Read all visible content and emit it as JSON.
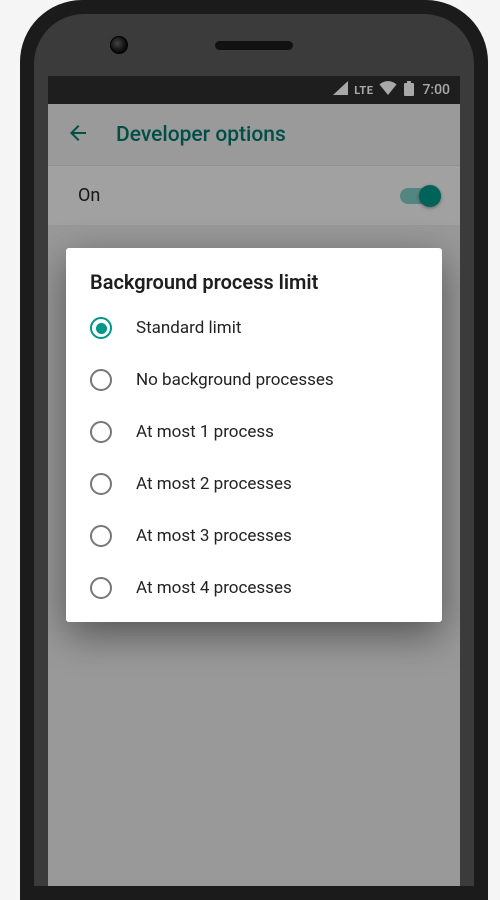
{
  "statusbar": {
    "network_label": "LTE",
    "time": "7:00"
  },
  "appbar": {
    "title": "Developer options"
  },
  "master_toggle": {
    "label": "On",
    "on": true
  },
  "dialog": {
    "title": "Background process limit",
    "options": [
      {
        "label": "Standard limit",
        "selected": true
      },
      {
        "label": "No background processes",
        "selected": false
      },
      {
        "label": "At most 1 process",
        "selected": false
      },
      {
        "label": "At most 2 processes",
        "selected": false
      },
      {
        "label": "At most 3 processes",
        "selected": false
      },
      {
        "label": "At most 4 processes",
        "selected": false
      }
    ]
  }
}
